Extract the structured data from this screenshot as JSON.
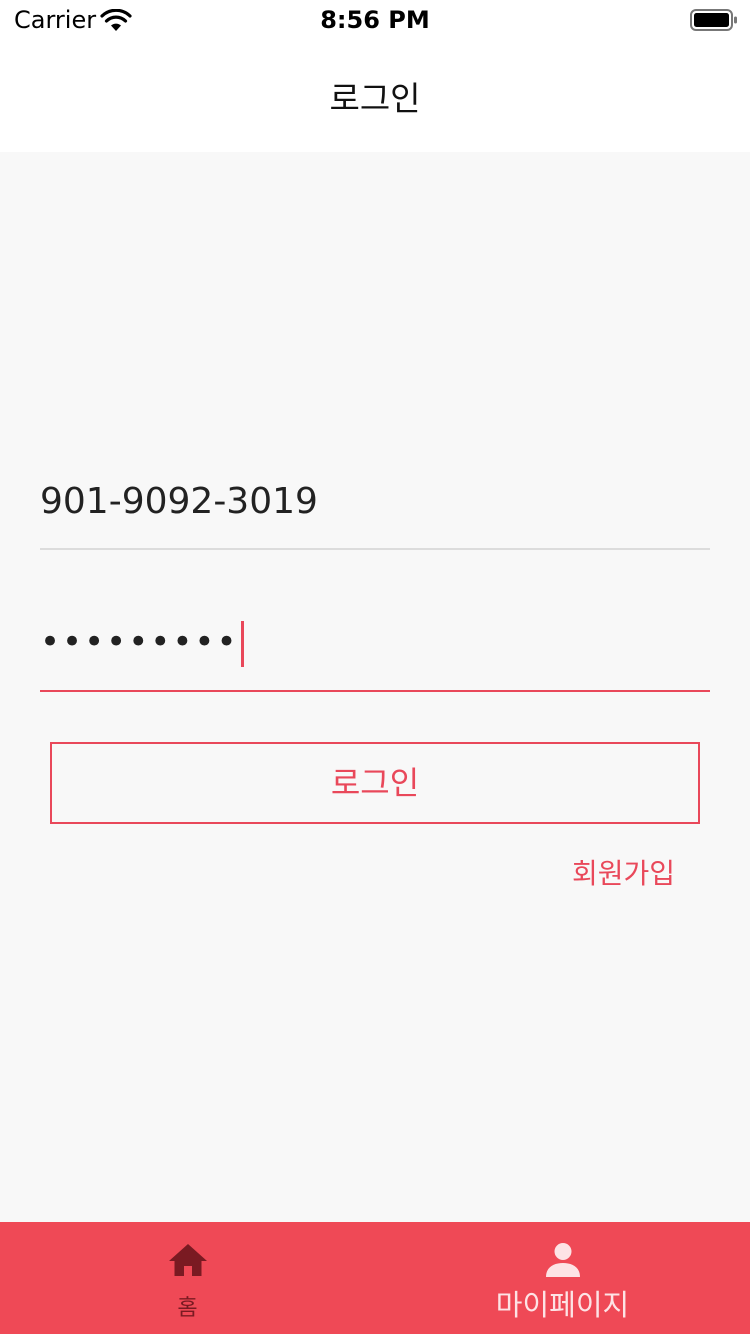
{
  "status_bar": {
    "carrier": "Carrier",
    "time": "8:56 PM"
  },
  "nav": {
    "title": "로그인"
  },
  "form": {
    "phone_value": "901-9092-3019",
    "password_value": "•••••••••",
    "login_label": "로그인",
    "signup_label": "회원가입"
  },
  "tab_bar": {
    "tabs": [
      {
        "label": "홈",
        "icon": "home-icon"
      },
      {
        "label": "마이페이지",
        "icon": "person-icon"
      }
    ]
  },
  "colors": {
    "accent": "#e9485a",
    "tab_bar_bg": "#ef4956",
    "background": "#f8f8f8"
  }
}
